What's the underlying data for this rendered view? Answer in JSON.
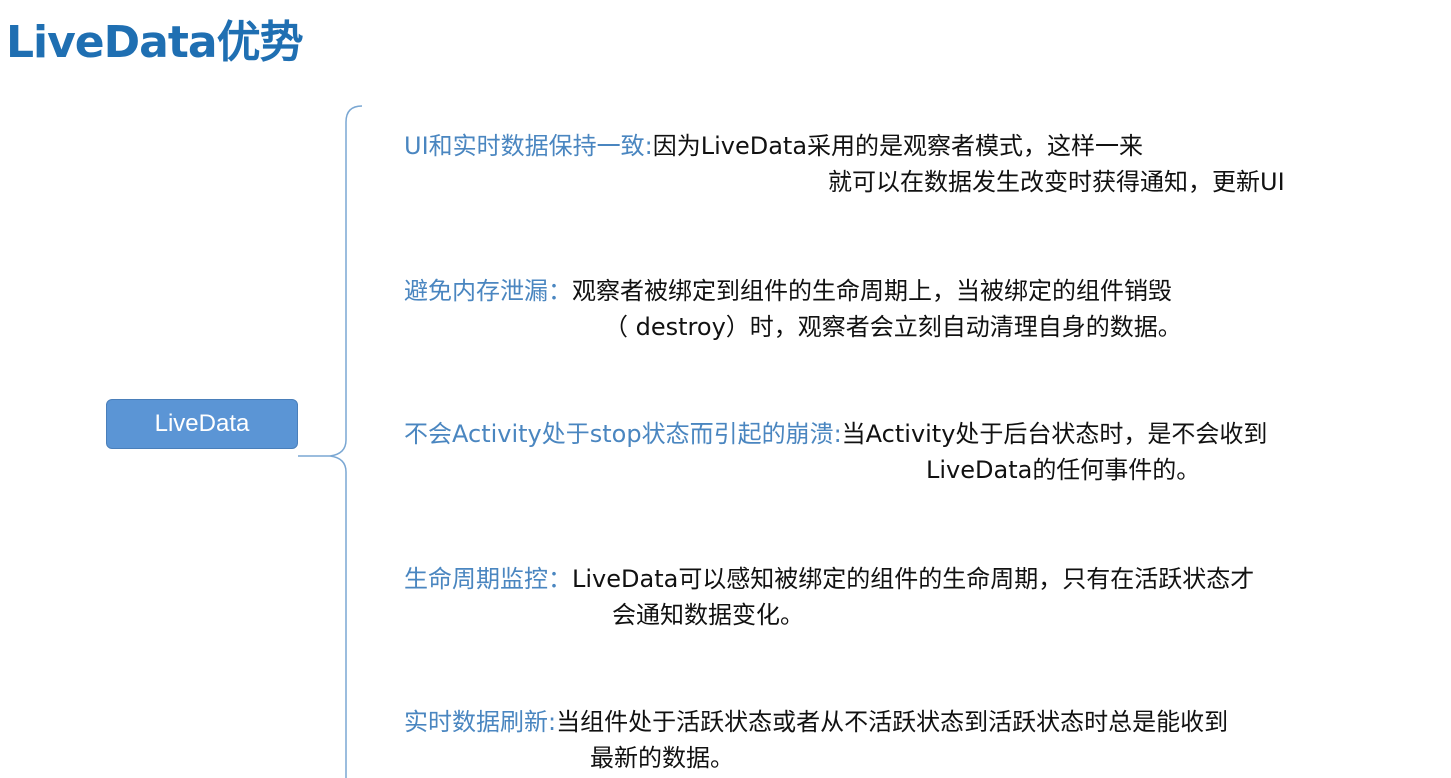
{
  "title": "LiveData优势",
  "root": {
    "label": "LiveData"
  },
  "items": [
    {
      "label": "UI和实时数据保持一致:",
      "text1": "因为LiveData采用的是观察者模式，这样一来",
      "text2": "就可以在数据发生改变时获得通知，更新UI"
    },
    {
      "label": "避免内存泄漏：",
      "text1": "观察者被绑定到组件的生命周期上，当被绑定的组件销毁",
      "text2": "（ destroy）时，观察者会立刻自动清理自身的数据。"
    },
    {
      "label": "不会Activity处于stop状态而引起的崩溃:",
      "text1": "当Activity处于后台状态时，是不会收到",
      "text2": "LiveData的任何事件的。"
    },
    {
      "label": "生命周期监控：",
      "text1": "LiveData可以感知被绑定的组件的生命周期，只有在活跃状态才",
      "text2": "会通知数据变化。"
    },
    {
      "label": "实时数据刷新:",
      "text1": "当组件处于活跃状态或者从不活跃状态到活跃状态时总是能收到",
      "text2": "最新的数据。"
    }
  ],
  "colors": {
    "title": "#1f6fb2",
    "label": "#4a86c0",
    "text": "#111111",
    "node_fill": "#5b95d5",
    "brace": "#7aa7d3"
  }
}
